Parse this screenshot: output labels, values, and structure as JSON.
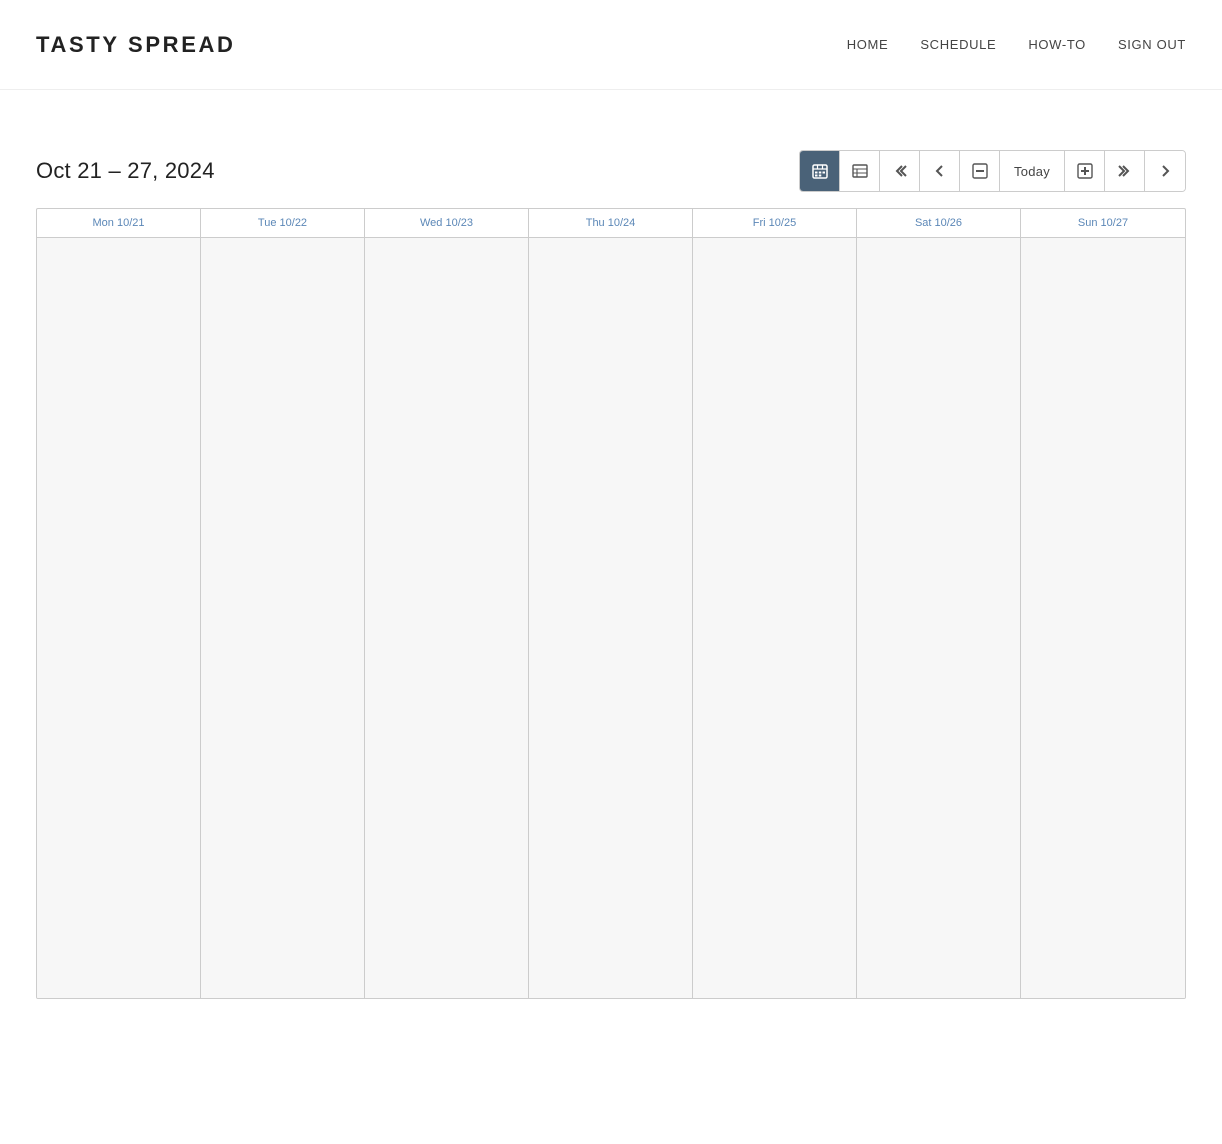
{
  "brand": "TASTY SPREAD",
  "nav": {
    "links": [
      {
        "id": "home",
        "label": "HOME"
      },
      {
        "id": "schedule",
        "label": "SCHEDULE"
      },
      {
        "id": "how-to",
        "label": "HOW-TO"
      },
      {
        "id": "sign-out",
        "label": "SIGN OUT"
      }
    ]
  },
  "calendar": {
    "dateRange": "Oct 21 – 27, 2024",
    "toolbar": {
      "calendarIcon": "calendar-icon",
      "listIcon": "list-icon",
      "prevFarLabel": "prev-far",
      "prevLabel": "prev",
      "zoomOutLabel": "zoom-out",
      "todayLabel": "Today",
      "zoomInLabel": "zoom-in",
      "nextFarLabel": "next-far",
      "nextLabel": "next"
    },
    "days": [
      {
        "id": "mon",
        "label": "Mon 10/21"
      },
      {
        "id": "tue",
        "label": "Tue 10/22"
      },
      {
        "id": "wed",
        "label": "Wed 10/23"
      },
      {
        "id": "thu",
        "label": "Thu 10/24"
      },
      {
        "id": "fri",
        "label": "Fri 10/25"
      },
      {
        "id": "sat",
        "label": "Sat 10/26"
      },
      {
        "id": "sun",
        "label": "Sun 10/27"
      }
    ]
  }
}
